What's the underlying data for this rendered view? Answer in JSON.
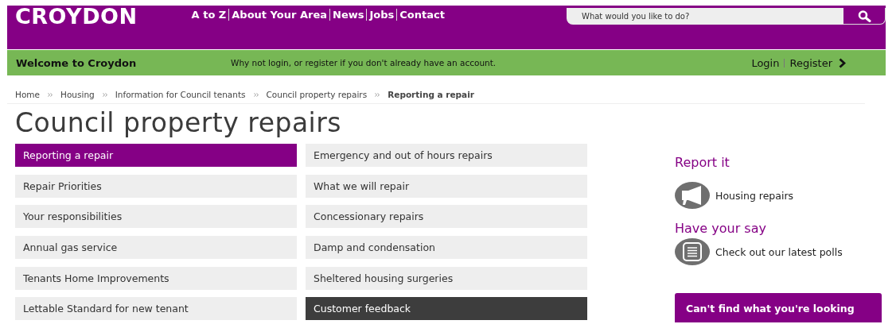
{
  "header": {
    "logo": "CROYDON",
    "nav": [
      "A to Z",
      "About Your Area",
      "News",
      "Jobs",
      "Contact"
    ],
    "search": {
      "placeholder": "What would you like to do?"
    }
  },
  "welcome_bar": {
    "title": "Welcome to Croydon",
    "message": "Why not login, or register if you don't already have an account.",
    "links": [
      "Login",
      "Register"
    ]
  },
  "breadcrumb": [
    {
      "label": "Home",
      "current": false
    },
    {
      "label": "Housing",
      "current": false
    },
    {
      "label": "Information for Council tenants",
      "current": false
    },
    {
      "label": "Council property repairs",
      "current": false
    },
    {
      "label": "Reporting a repair",
      "current": true
    }
  ],
  "page_title": "Council property repairs",
  "menu": [
    {
      "label": "Reporting a repair",
      "selected": true,
      "hovered": false
    },
    {
      "label": "Emergency and out of hours repairs",
      "selected": false,
      "hovered": false
    },
    {
      "label": "Repair Priorities",
      "selected": false,
      "hovered": false
    },
    {
      "label": "What we will repair",
      "selected": false,
      "hovered": false
    },
    {
      "label": "Your responsibilities",
      "selected": false,
      "hovered": false
    },
    {
      "label": "Concessionary repairs",
      "selected": false,
      "hovered": false
    },
    {
      "label": "Annual gas service",
      "selected": false,
      "hovered": false
    },
    {
      "label": "Damp and condensation",
      "selected": false,
      "hovered": false
    },
    {
      "label": "Tenants Home Improvements",
      "selected": false,
      "hovered": false
    },
    {
      "label": "Sheltered housing surgeries",
      "selected": false,
      "hovered": false
    },
    {
      "label": "Lettable Standard for new tenant",
      "selected": false,
      "hovered": false
    },
    {
      "label": "Customer feedback",
      "selected": false,
      "hovered": true
    }
  ],
  "sidebar": {
    "sections": [
      {
        "heading": "Report it",
        "link": {
          "kind": "megaphone",
          "label": "Housing repairs"
        }
      },
      {
        "heading": "Have your say",
        "link": {
          "kind": "list",
          "label": "Check out our latest polls"
        }
      }
    ],
    "button": "Can't find what you're looking"
  }
}
